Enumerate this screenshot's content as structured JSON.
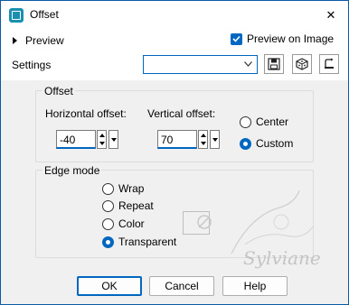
{
  "window": {
    "title": "Offset",
    "close_symbol": "✕"
  },
  "top": {
    "preview_label": "Preview",
    "preview_on_image_label": "Preview on Image",
    "preview_on_image_checked": true,
    "settings_label": "Settings",
    "settings_value": ""
  },
  "offset": {
    "group_label": "Offset",
    "horizontal_label": "Horizontal offset:",
    "horizontal_value": "-40",
    "vertical_label": "Vertical offset:",
    "vertical_value": "70",
    "center_label": "Center",
    "custom_label": "Custom",
    "selected": "Custom"
  },
  "edge": {
    "group_label": "Edge mode",
    "options": [
      "Wrap",
      "Repeat",
      "Color",
      "Transparent"
    ],
    "selected": "Transparent"
  },
  "buttons": {
    "ok": "OK",
    "cancel": "Cancel",
    "help": "Help"
  },
  "watermark": {
    "signature": "Sylviane"
  },
  "colors": {
    "accent": "#0067c0",
    "titlebar_icon": "#1a8fb0"
  }
}
